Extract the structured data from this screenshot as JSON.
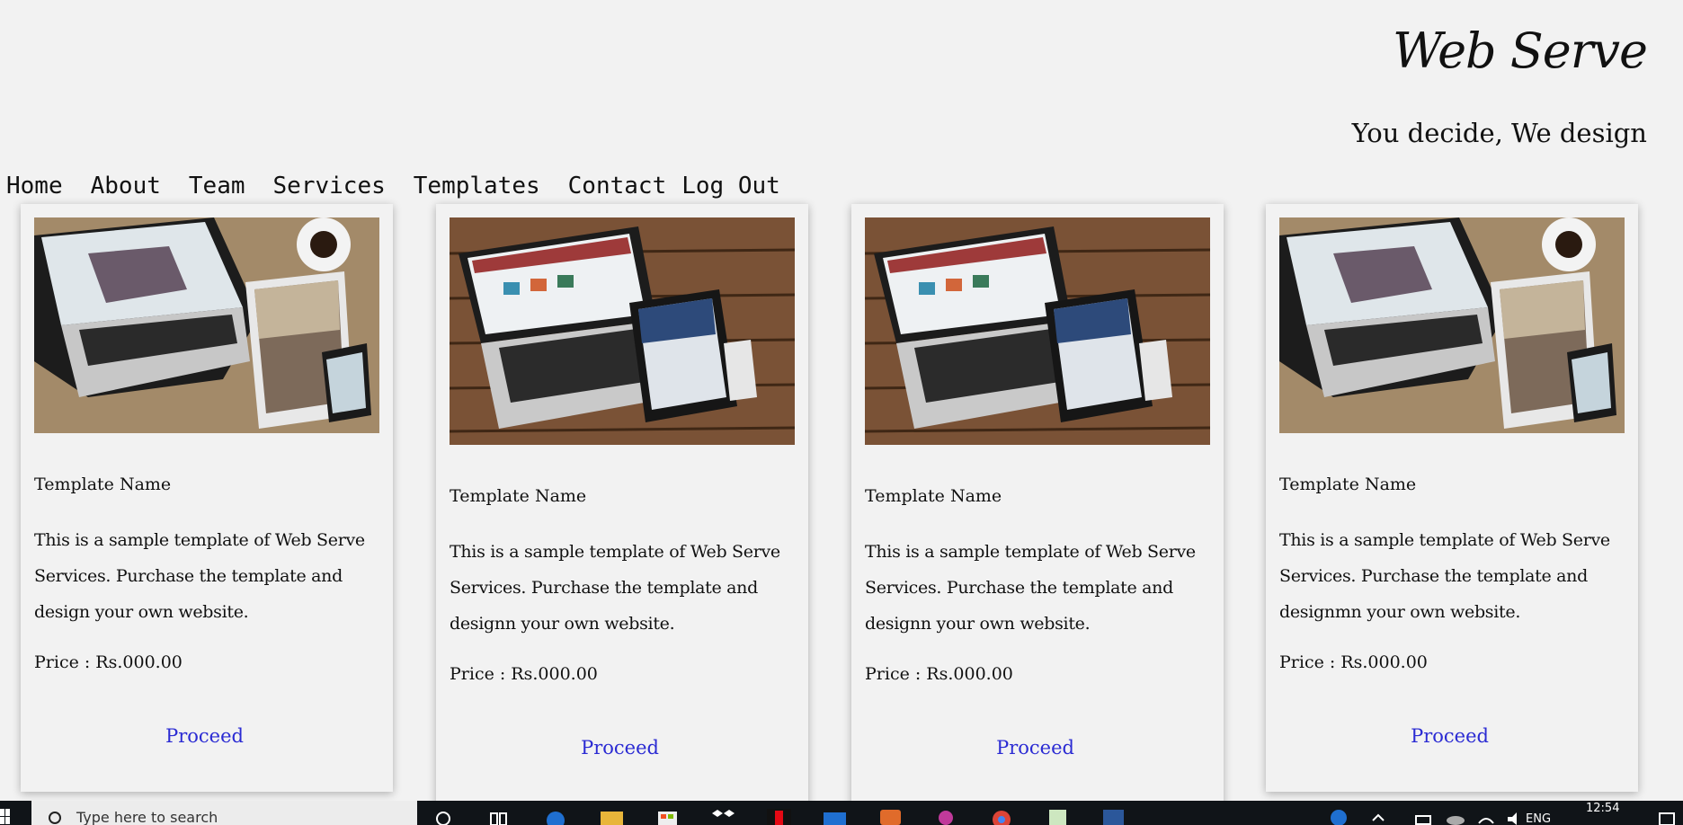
{
  "brand": {
    "title": "Web Serve",
    "tagline": "You decide, We design"
  },
  "nav": {
    "items": [
      {
        "label": "Home"
      },
      {
        "label": "About"
      },
      {
        "label": "Team"
      },
      {
        "label": "Services"
      },
      {
        "label": "Templates"
      },
      {
        "label": "Contact"
      },
      {
        "label": "Log Out"
      }
    ]
  },
  "cards": [
    {
      "image": "laptop-tablet-phone-desk-photo",
      "name": "Template Name",
      "description": "This is a sample template of Web Serve Services. Purchase the template and design your own website.",
      "price": "Price : Rs.000.00",
      "action": "Proceed"
    },
    {
      "image": "laptop-tablet-phone-wood-photo",
      "name": "Template Name",
      "description": "This is a sample template of Web Serve Services. Purchase the template and designn your own website.",
      "price": "Price : Rs.000.00",
      "action": "Proceed"
    },
    {
      "image": "laptop-tablet-phone-wood-photo",
      "name": "Template Name",
      "description": "This is a sample template of Web Serve Services. Purchase the template and designn your own website.",
      "price": "Price : Rs.000.00",
      "action": "Proceed"
    },
    {
      "image": "laptop-tablet-phone-desk-photo",
      "name": "Template Name",
      "description": "This is a sample template of Web Serve Services. Purchase the template and designmn your own website.",
      "price": "Price : Rs.000.00",
      "action": "Proceed"
    }
  ],
  "taskbar": {
    "search_placeholder": "Type here to search",
    "language": "ENG",
    "time": "12:54"
  },
  "colors": {
    "page_background": "#f2f2f2",
    "link": "#2b2bd3",
    "taskbar": "#101418"
  }
}
